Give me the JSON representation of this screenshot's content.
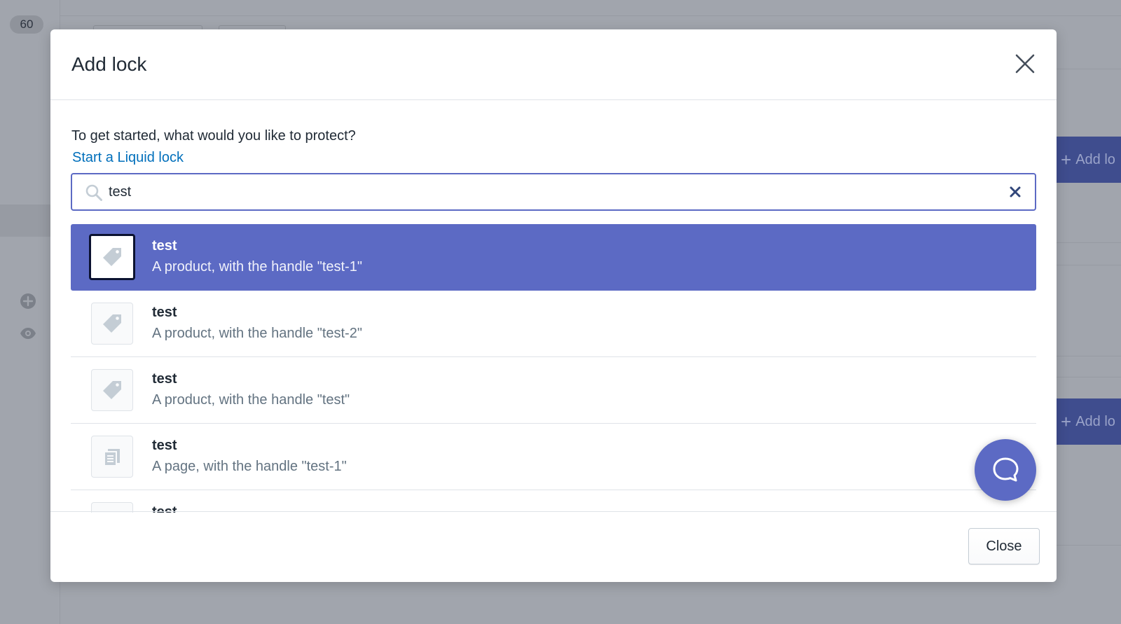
{
  "background": {
    "badge_count": "60",
    "add_lock_label": "Add lo"
  },
  "modal": {
    "title": "Add lock",
    "prompt": "To get started, what would you like to protect?",
    "liquid_link": "Start a Liquid lock",
    "search": {
      "value": "test"
    },
    "results": [
      {
        "title": "test",
        "subtitle": "A product, with the handle \"test-1\"",
        "icon": "tag-icon",
        "selected": true
      },
      {
        "title": "test",
        "subtitle": "A product, with the handle \"test-2\"",
        "icon": "tag-icon",
        "selected": false
      },
      {
        "title": "test",
        "subtitle": "A product, with the handle \"test\"",
        "icon": "tag-icon",
        "selected": false
      },
      {
        "title": "test",
        "subtitle": "A page, with the handle \"test-1\"",
        "icon": "page-icon",
        "selected": false
      },
      {
        "title": "test",
        "subtitle": "",
        "icon": "tag-icon",
        "selected": false
      }
    ],
    "close_label": "Close"
  },
  "colors": {
    "accent": "#5c6ac4",
    "link": "#006fbb",
    "backdrop": "#a1a5ad"
  }
}
